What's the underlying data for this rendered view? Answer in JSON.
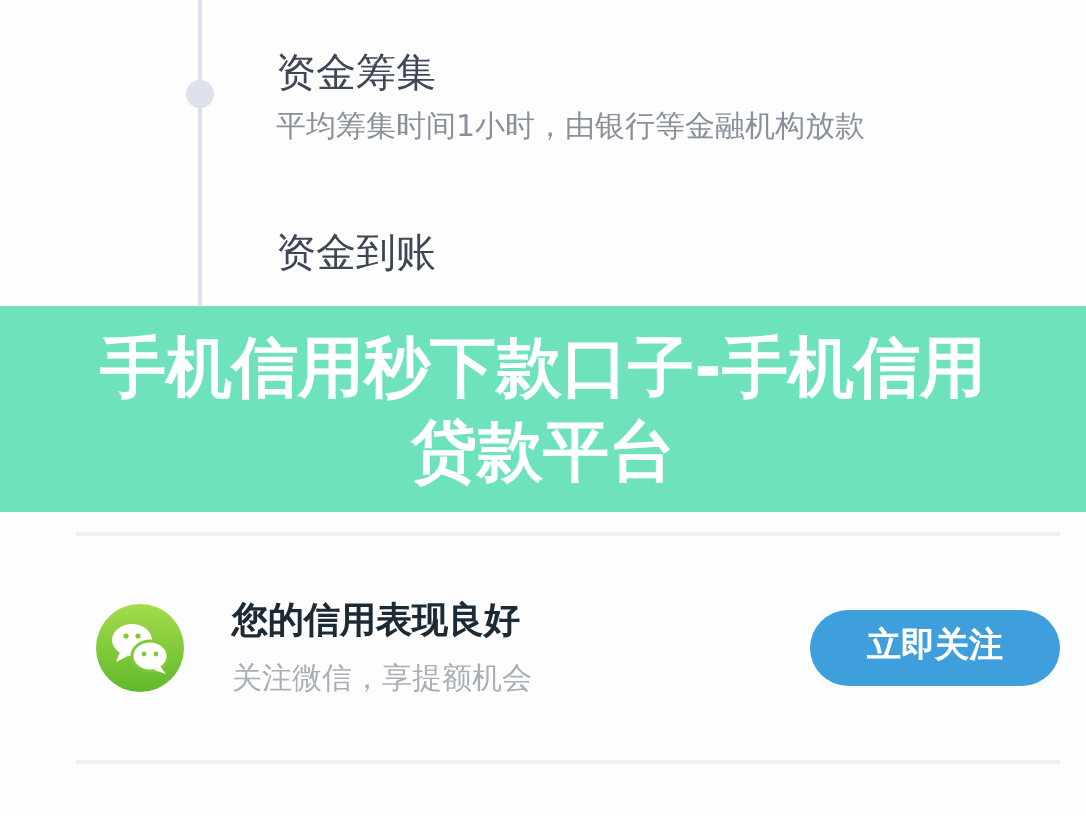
{
  "steps": [
    {
      "title": "资金筹集",
      "description": "平均筹集时间1小时，由银行等金融机构放款"
    },
    {
      "title": "资金到账"
    }
  ],
  "banner": {
    "title": "手机信用秒下款口子-手机信用贷款平台"
  },
  "promo": {
    "title": "您的信用表现良好",
    "subtitle": "关注微信，享提额机会",
    "button": "立即关注"
  }
}
